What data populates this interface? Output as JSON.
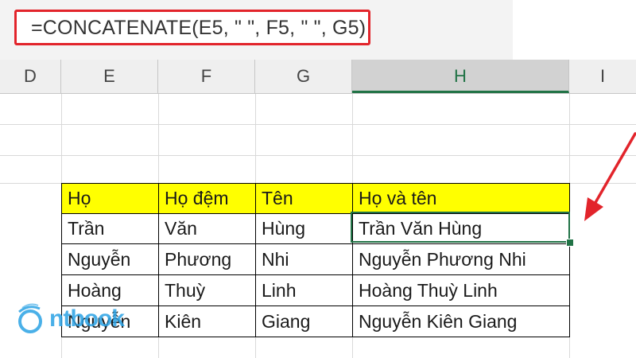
{
  "formula_bar": {
    "formula": "=CONCATENATE(E5, \" \", F5, \" \", G5)"
  },
  "column_headers": [
    "D",
    "E",
    "F",
    "G",
    "H",
    "I"
  ],
  "selected_column": "H",
  "table": {
    "headers": [
      "Họ",
      "Họ đệm",
      "Tên",
      "Họ và tên"
    ],
    "rows": [
      [
        "Trần",
        "Văn",
        "Hùng",
        "Trần Văn Hùng"
      ],
      [
        "Nguyễn",
        "Phương",
        "Nhi",
        "Nguyễn  Phương  Nhi"
      ],
      [
        "Hoàng",
        "Thuỳ",
        "Linh",
        "Hoàng  Thuỳ  Linh"
      ],
      [
        "Nguyễn",
        "Kiên",
        "Giang",
        "Nguyễn Kiên Giang"
      ]
    ]
  },
  "logo": {
    "text": "ntbook",
    "icon": "logo-icon"
  },
  "colors": {
    "highlight_border": "#e2242b",
    "header_fill": "#ffff00",
    "selection": "#217346",
    "arrow": "#e2242b"
  }
}
